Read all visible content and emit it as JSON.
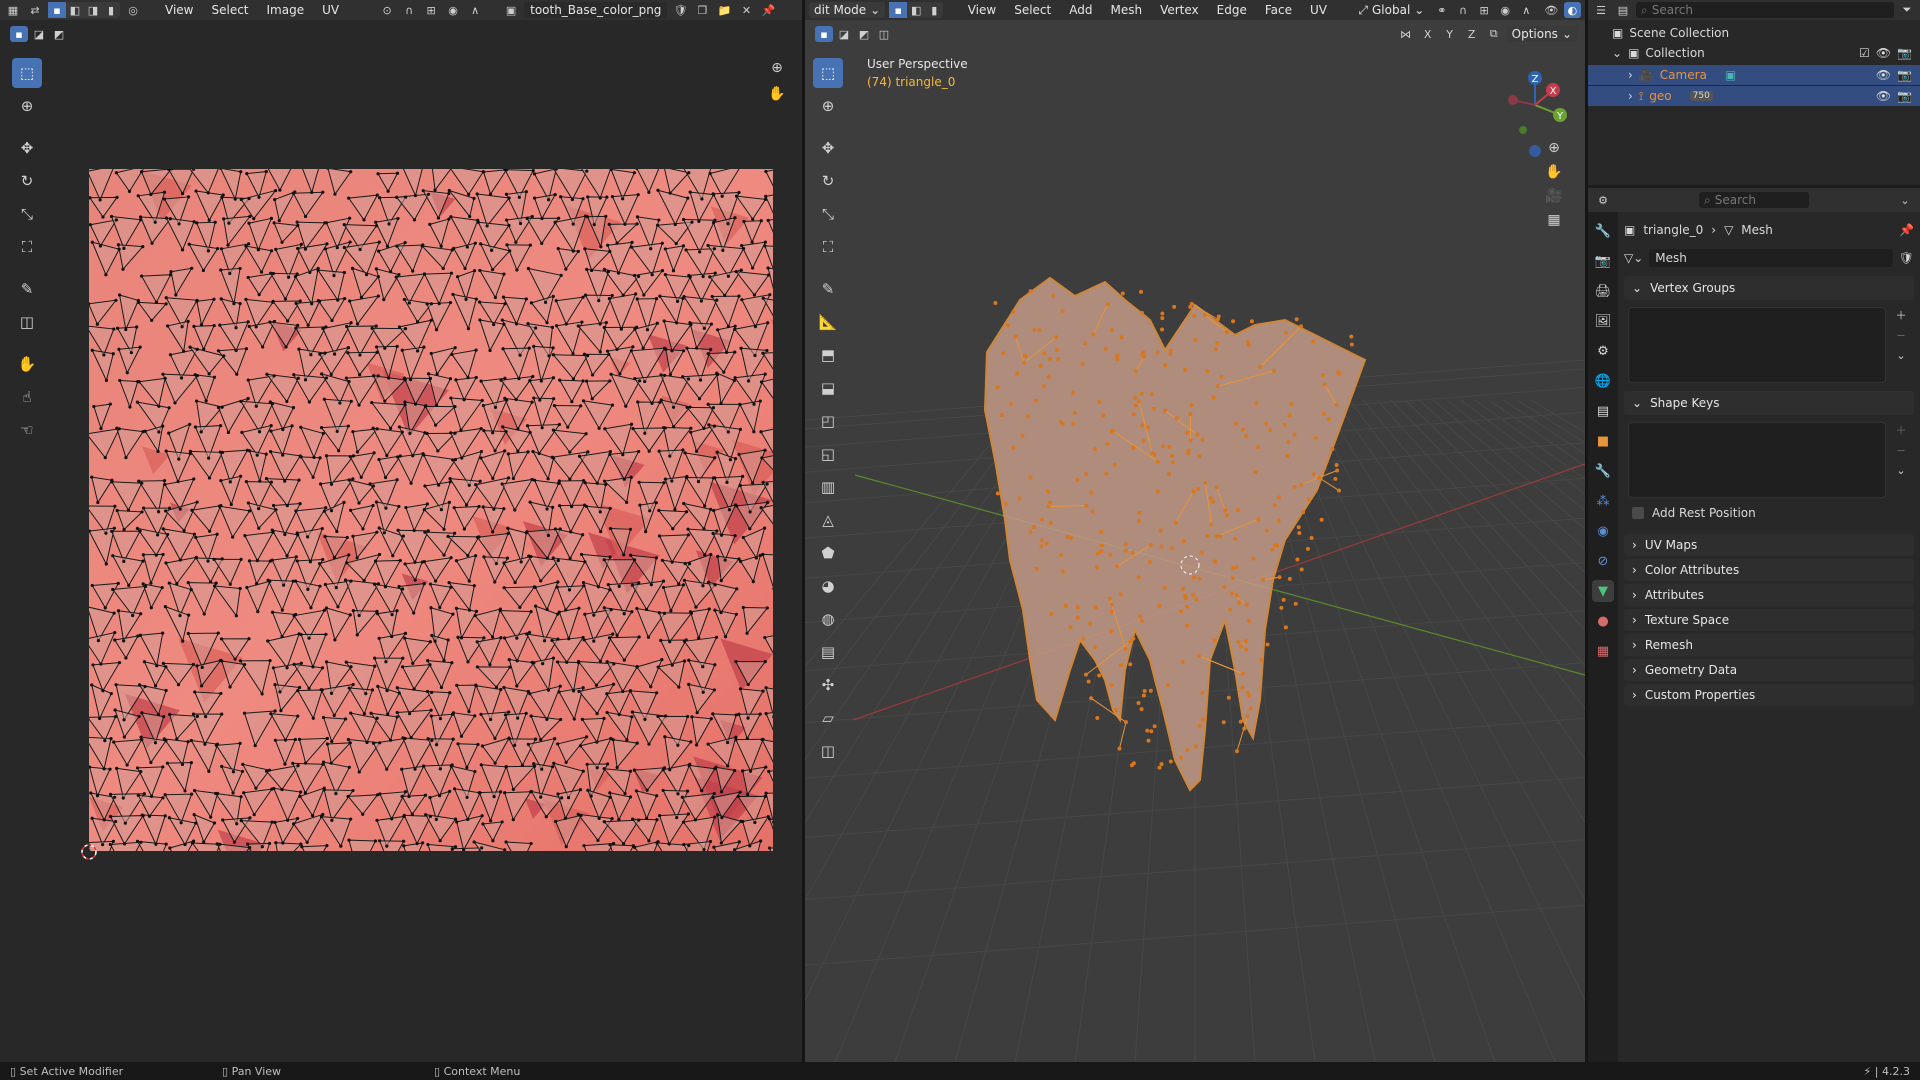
{
  "uv_header": {
    "menus": [
      "View",
      "Select",
      "Image",
      "UV"
    ],
    "image_name": "tooth_Base_color_png"
  },
  "viewport_header": {
    "mode": "dit Mode",
    "menus": [
      "View",
      "Select",
      "Add",
      "Mesh",
      "Vertex",
      "Edge",
      "Face",
      "UV"
    ],
    "transform_orientation": "Global",
    "axes": [
      "X",
      "Y",
      "Z"
    ],
    "options_label": "Options"
  },
  "viewport": {
    "perspective_label": "User Perspective",
    "object_label": "(74) triangle_0",
    "gizmo_axes": [
      "Z",
      "Y",
      "X"
    ]
  },
  "outliner": {
    "search_placeholder": "Search",
    "scene_collection": "Scene Collection",
    "collection": "Collection",
    "items": [
      {
        "label": "Camera",
        "icon": "camera-icon",
        "color": "#e8943a"
      },
      {
        "label": "geo",
        "icon": "armature-icon",
        "color": "#e8943a",
        "badge": "750"
      }
    ]
  },
  "properties": {
    "search_placeholder": "Search",
    "breadcrumb_object": "triangle_0",
    "breadcrumb_data": "Mesh",
    "mesh_name": "Mesh",
    "panels_open": [
      {
        "label": "Vertex Groups"
      },
      {
        "label": "Shape Keys"
      }
    ],
    "add_rest_position": "Add Rest Position",
    "panels_closed": [
      "UV Maps",
      "Color Attributes",
      "Attributes",
      "Texture Space",
      "Remesh",
      "Geometry Data",
      "Custom Properties"
    ]
  },
  "statusbar": {
    "left": "Set Active Modifier",
    "middle": "Pan View",
    "right": "Context Menu",
    "version": "4.2.3"
  },
  "colors": {
    "accent": "#4772b3",
    "selection_orange": "#e8943a",
    "uv_texture": "#e87b72",
    "background": "#303030"
  }
}
